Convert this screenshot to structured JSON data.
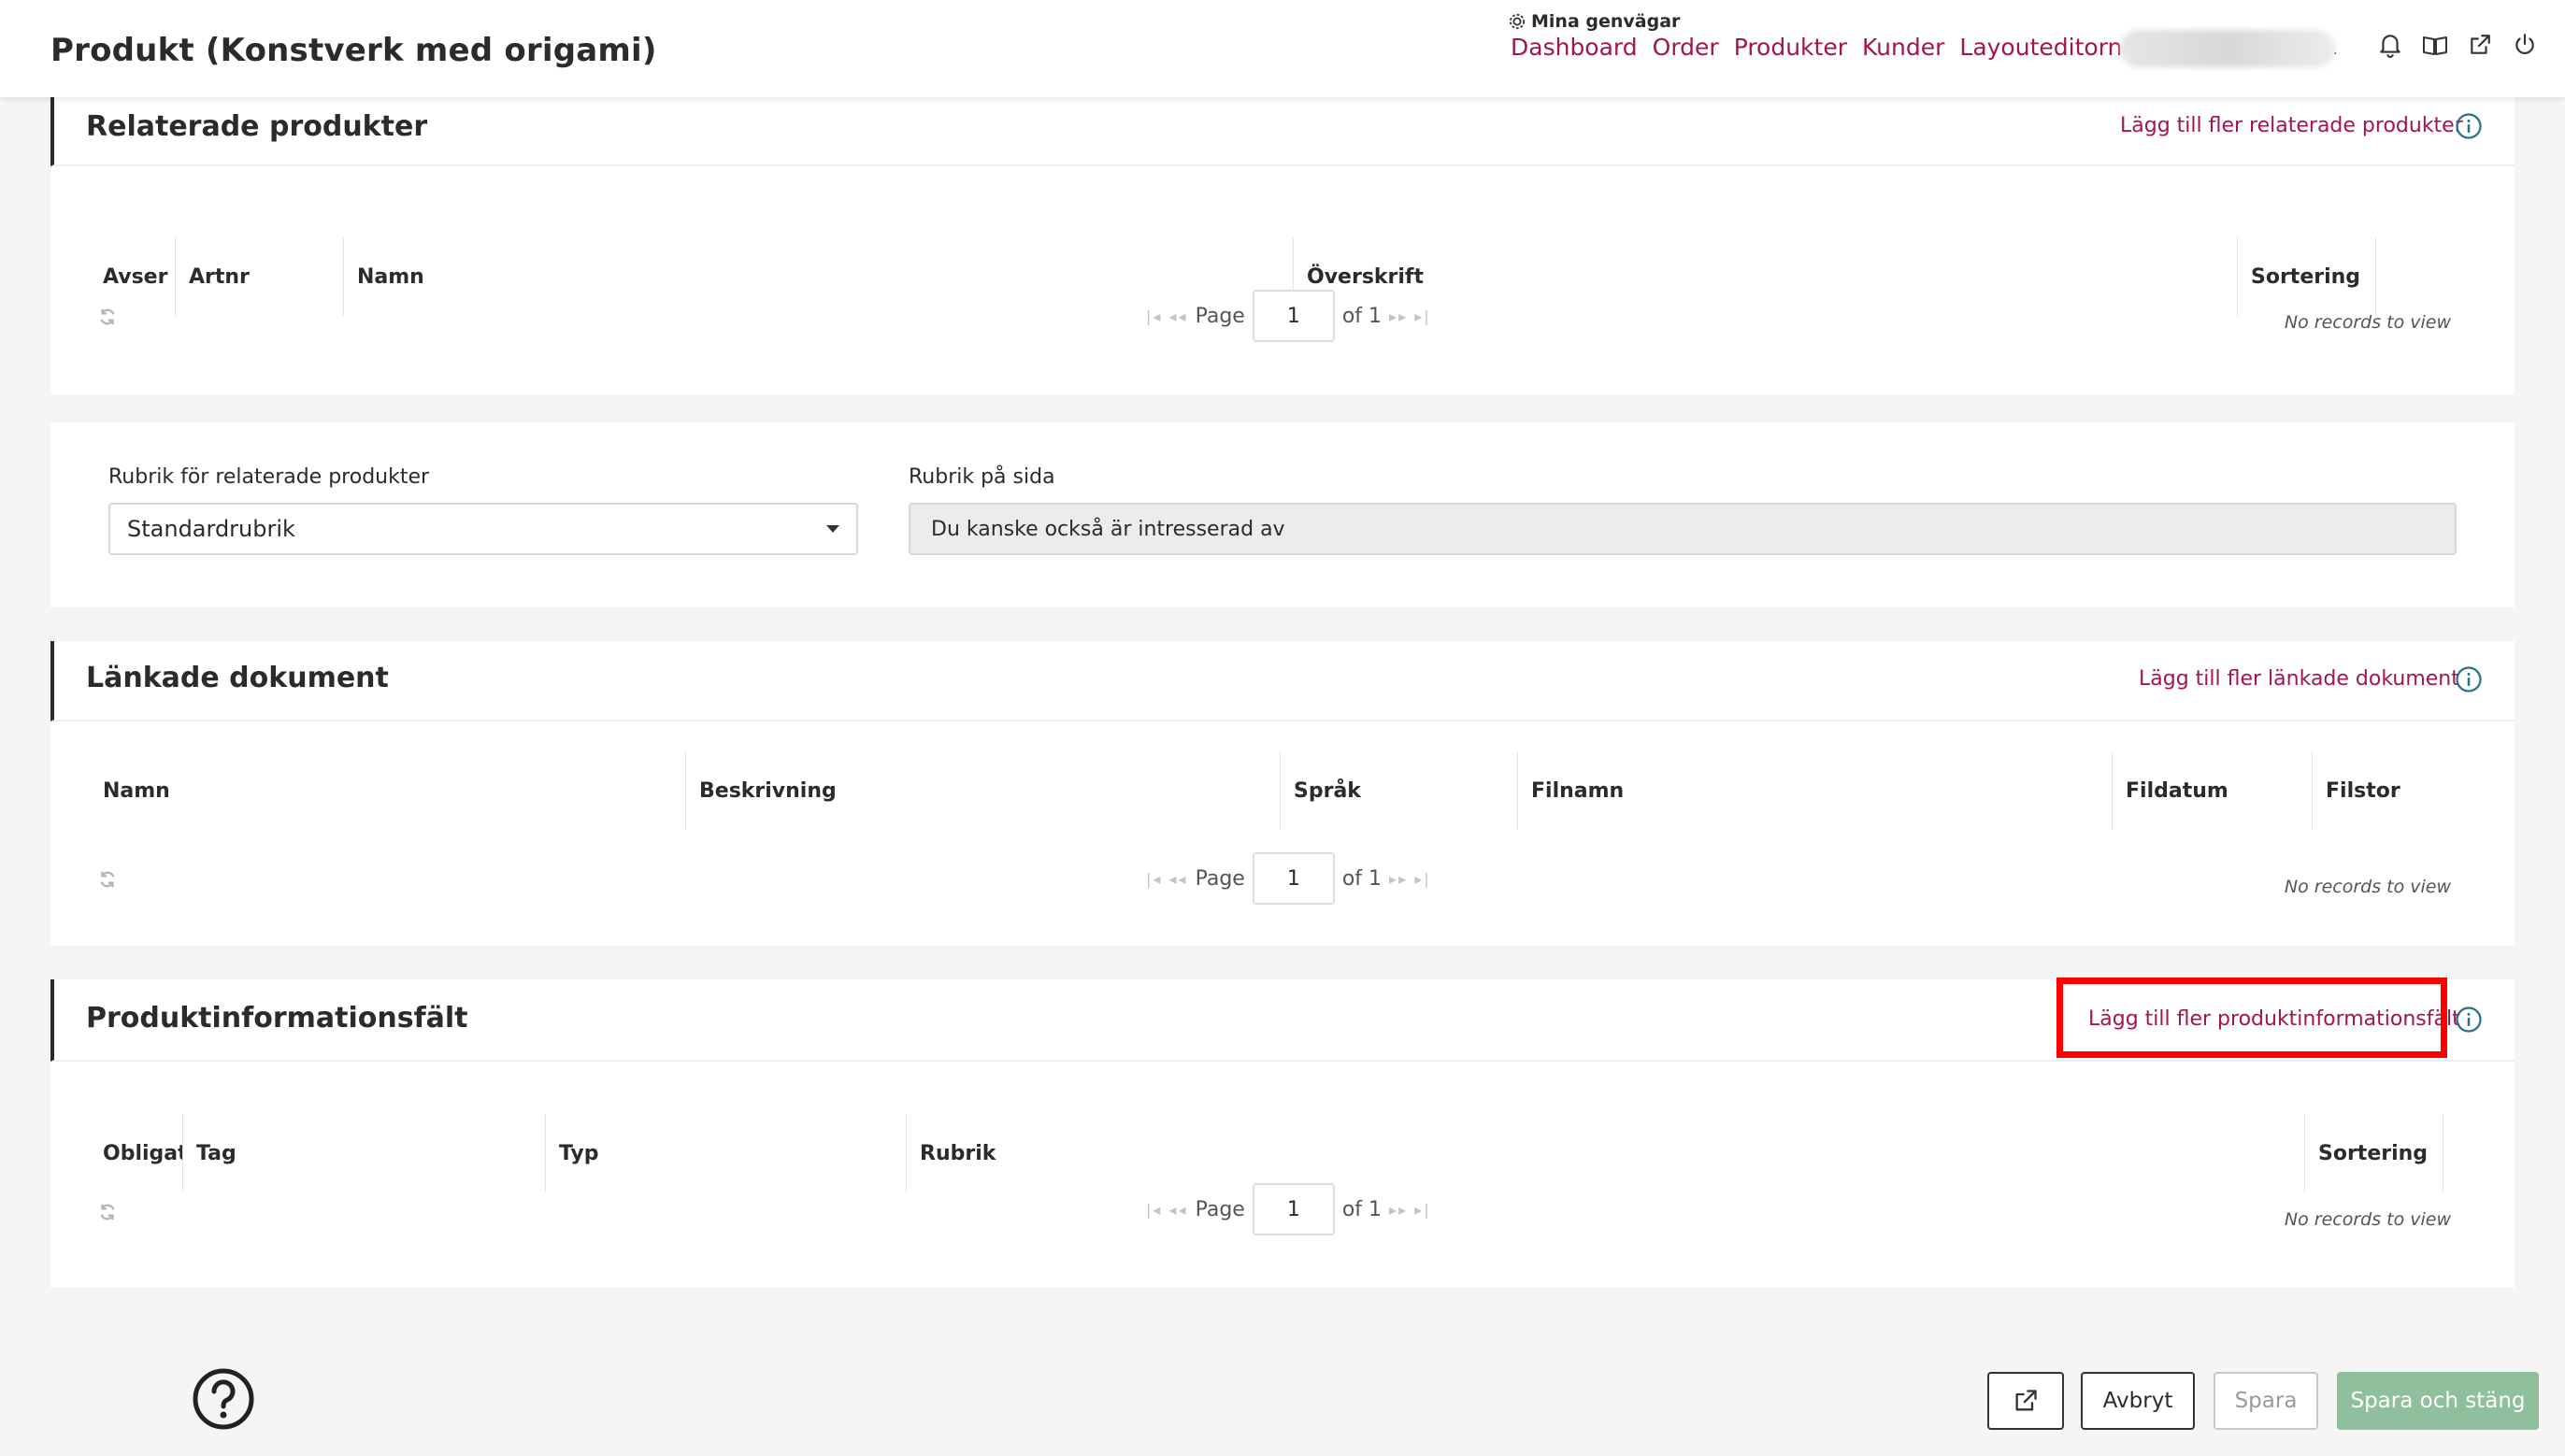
{
  "header": {
    "title": "Produkt (Konstverk med origami)",
    "shortcuts_label": "Mina genvägar",
    "nav": [
      "Dashboard",
      "Order",
      "Produkter",
      "Kunder",
      "Layouteditorn"
    ],
    "user_suffix": "·"
  },
  "related_products": {
    "title": "Relaterade produkter",
    "add_link": "Lägg till fler relaterade produkter",
    "columns": [
      "Avser",
      "Artnr",
      "Namn",
      "Överskrift",
      "Sortering"
    ],
    "pager": {
      "page_label": "Page",
      "page_value": "1",
      "of_label": "of 1"
    },
    "empty_text": "No records to view"
  },
  "headline_settings": {
    "rubric_label": "Rubrik för relaterade produkter",
    "rubric_value": "Standardrubrik",
    "page_rubric_label": "Rubrik på sida",
    "page_rubric_value": "Du kanske också är intresserad av"
  },
  "linked_documents": {
    "title": "Länkade dokument",
    "add_link": "Lägg till fler länkade dokument",
    "columns": [
      "Namn",
      "Beskrivning",
      "Språk",
      "Filnamn",
      "Fildatum",
      "Filstorl"
    ],
    "pager": {
      "page_label": "Page",
      "page_value": "1",
      "of_label": "of 1"
    },
    "empty_text": "No records to view"
  },
  "product_info_fields": {
    "title": "Produktinformationsfält",
    "add_link": "Lägg till fler produktinformationsfält",
    "columns": [
      "Obligatoriskt",
      "Tag",
      "Typ",
      "Rubrik",
      "Sortering"
    ],
    "pager": {
      "page_label": "Page",
      "page_value": "1",
      "of_label": "of 1"
    },
    "empty_text": "No records to view"
  },
  "footer": {
    "cancel": "Avbryt",
    "save": "Spara",
    "save_close": "Spara och stäng"
  },
  "colors": {
    "accent": "#a3154f",
    "highlight": "#ff0000",
    "primary_button": "#8fbf9c"
  }
}
